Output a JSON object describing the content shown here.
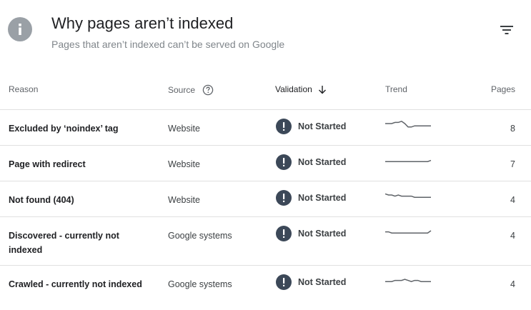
{
  "header": {
    "title": "Why pages aren’t indexed",
    "subtitle": "Pages that aren’t indexed can’t be served on Google"
  },
  "columns": {
    "reason": "Reason",
    "source": "Source",
    "validation": "Validation",
    "trend": "Trend",
    "pages": "Pages"
  },
  "rows": [
    {
      "reason": "Excluded by ‘noindex’ tag",
      "source": "Website",
      "validation": "Not Started",
      "pages": "8",
      "trend": [
        5,
        5,
        5,
        6,
        6,
        7,
        5,
        2,
        2,
        3,
        3,
        3,
        3,
        3,
        3
      ]
    },
    {
      "reason": "Page with redirect",
      "source": "Website",
      "validation": "Not Started",
      "pages": "7",
      "trend": [
        3,
        3,
        3,
        3,
        3,
        3,
        3,
        3,
        3,
        3,
        3,
        3,
        3,
        3,
        4
      ]
    },
    {
      "reason": "Not found (404)",
      "source": "Website",
      "validation": "Not Started",
      "pages": "4",
      "trend": [
        6,
        5,
        5,
        4,
        5,
        4,
        4,
        4,
        4,
        3,
        3,
        3,
        3,
        3,
        3
      ]
    },
    {
      "reason": "Discovered - currently not indexed",
      "source": "Google systems",
      "validation": "Not Started",
      "pages": "4",
      "trend": [
        4,
        4,
        3,
        3,
        3,
        3,
        3,
        3,
        3,
        3,
        3,
        3,
        3,
        3,
        5
      ]
    },
    {
      "reason": "Crawled - currently not indexed",
      "source": "Google systems",
      "validation": "Not Started",
      "pages": "4",
      "trend": [
        3,
        3,
        3,
        4,
        4,
        4,
        5,
        4,
        3,
        4,
        4,
        3,
        3,
        3,
        3
      ]
    }
  ],
  "icons": {
    "info": "info-icon",
    "filter": "filter-icon",
    "help": "help-circle-icon",
    "sort": "arrow-down-icon",
    "alert": "exclamation-circle-icon"
  },
  "colors": {
    "alert_icon": "#3c4858",
    "info_icon": "#9aa0a6",
    "trend_line": "#5f6368",
    "divider": "#e0e0e0"
  }
}
